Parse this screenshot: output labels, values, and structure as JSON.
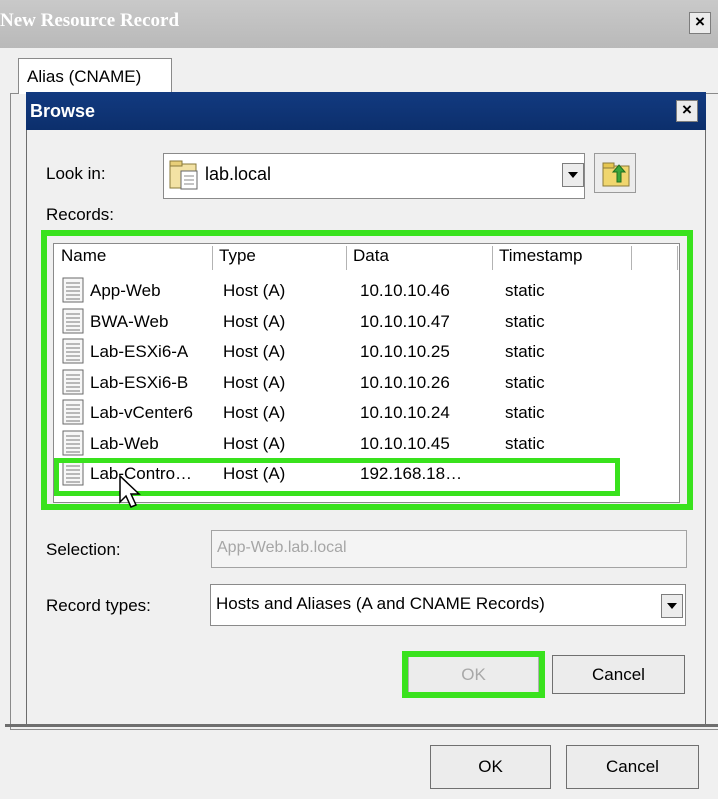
{
  "window": {
    "title": "New Resource Record",
    "tab_label": "Alias (CNAME)",
    "ok_label": "OK",
    "cancel_label": "Cancel"
  },
  "browse": {
    "title": "Browse",
    "look_in_label": "Look in:",
    "look_in_value": "lab.local",
    "records_label": "Records:",
    "columns": [
      "Name",
      "Type",
      "Data",
      "Timestamp"
    ],
    "rows": [
      {
        "name": "App-Web",
        "type": "Host (A)",
        "data": "10.10.10.46",
        "timestamp": "static"
      },
      {
        "name": "BWA-Web",
        "type": "Host (A)",
        "data": "10.10.10.47",
        "timestamp": "static"
      },
      {
        "name": "Lab-ESXi6-A",
        "type": "Host (A)",
        "data": "10.10.10.25",
        "timestamp": "static"
      },
      {
        "name": "Lab-ESXi6-B",
        "type": "Host (A)",
        "data": "10.10.10.26",
        "timestamp": "static"
      },
      {
        "name": "Lab-vCenter6",
        "type": "Host (A)",
        "data": "10.10.10.24",
        "timestamp": "static"
      },
      {
        "name": "Lab-Web",
        "type": "Host (A)",
        "data": "10.10.10.45",
        "timestamp": "static"
      },
      {
        "name": "Lab-Contro…",
        "type": "Host (A)",
        "data": "192.168.18…",
        "timestamp": ""
      }
    ],
    "selection_label": "Selection:",
    "selection_value": "App-Web.lab.local",
    "record_types_label": "Record types:",
    "record_types_value": "Hosts and Aliases (A and CNAME Records)",
    "ok_label": "OK",
    "cancel_label": "Cancel"
  },
  "colors": {
    "highlight": "#39e21d",
    "browse_titlebar": "#0c2f6c"
  },
  "icons": {
    "close": "close-icon",
    "zone": "zone-folder-icon",
    "up": "up-folder-icon",
    "record": "record-icon",
    "cursor": "mouse-cursor-icon"
  }
}
